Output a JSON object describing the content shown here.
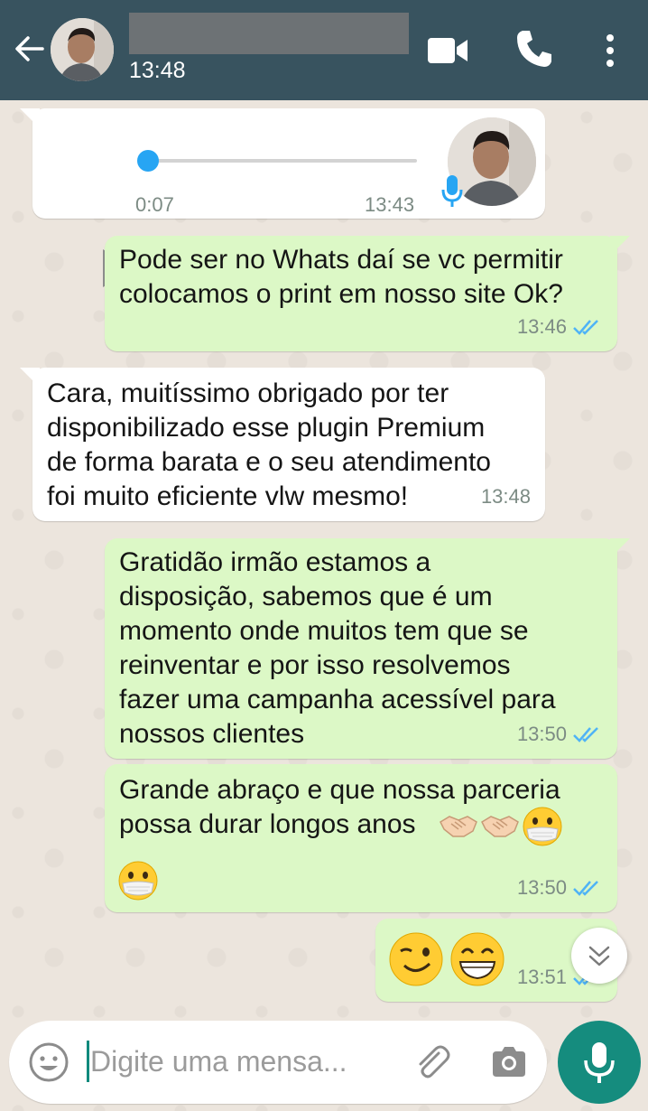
{
  "header": {
    "contact_name": "",
    "time": "13:48"
  },
  "voice_message": {
    "duration": "0:07",
    "time": "13:43",
    "progress": 0
  },
  "messages": [
    {
      "text": "Pode ser no Whats daí se vc permitir\ncolocamos o print em nosso site Ok?",
      "time": "13:46",
      "direction": "out",
      "status": "read"
    },
    {
      "text": "Cara, muitíssimo obrigado por ter\ndisponibilizado esse plugin Premium\nde forma barata e o seu atendimento\nfoi muito eficiente vlw mesmo!",
      "time": "13:48",
      "direction": "in"
    },
    {
      "text": "Gratidão irmão estamos a\ndisposição, sabemos que é um\nmomento onde muitos tem que se\nreinventar e por isso resolvemos\nfazer uma campanha acessível para\nnossos clientes",
      "time": "13:50",
      "direction": "out",
      "status": "read"
    },
    {
      "text": "Grande abraço e que nossa parceria\npossa durar longos anos",
      "time": "13:50",
      "direction": "out",
      "status": "read",
      "emojis_inline": [
        "handshake",
        "handshake",
        "mask-face"
      ],
      "emojis_next_line": [
        "mask-face"
      ]
    },
    {
      "text": "",
      "time": "13:51",
      "direction": "out",
      "status": "read",
      "emojis_inline": [
        "wink-face",
        "grin-face"
      ]
    }
  ],
  "composer": {
    "placeholder": "Digite uma mensa..."
  },
  "colors": {
    "header": "#38535f",
    "bubble_out": "#dcf8c6",
    "bubble_in": "#ffffff",
    "read_ticks": "#4fb3f6",
    "fab": "#158c7e"
  },
  "icons": [
    "back-arrow-icon",
    "video-call-icon",
    "phone-icon",
    "more-vertical-icon",
    "play-icon",
    "mic-icon",
    "emoji-icon",
    "attach-icon",
    "camera-icon",
    "chevron-double-down-icon"
  ]
}
